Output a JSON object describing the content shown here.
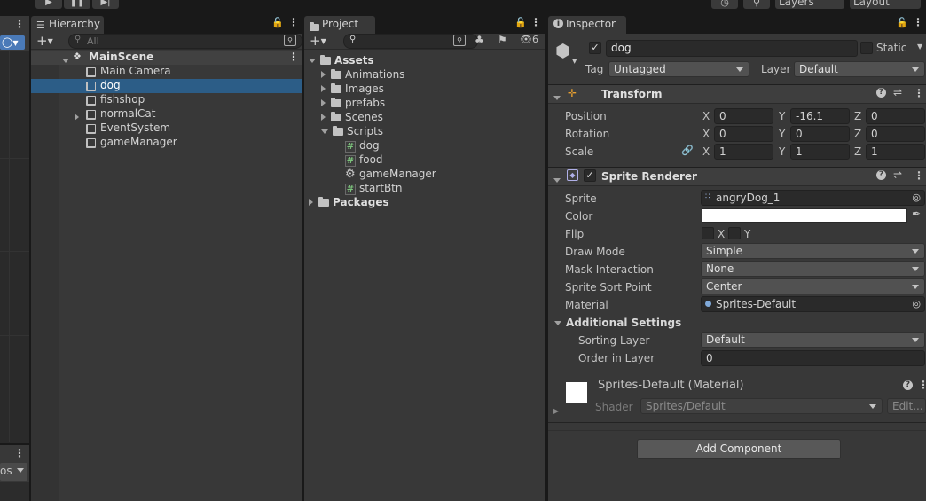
{
  "toolbar": {
    "play_icon": "play-icon",
    "pause_icon": "pause-icon",
    "step_icon": "step-icon",
    "layers_label": "Layers",
    "layout_label": "Layout"
  },
  "hierarchy": {
    "tab_label": "Hierarchy",
    "search_placeholder": "All",
    "scene_name": "MainScene",
    "items": [
      {
        "name": "Main Camera"
      },
      {
        "name": "dog"
      },
      {
        "name": "fishshop"
      },
      {
        "name": "normalCat"
      },
      {
        "name": "EventSystem"
      },
      {
        "name": "gameManager"
      }
    ]
  },
  "left_panel": {
    "dropdown_label": "os"
  },
  "project": {
    "tab_label": "Project",
    "hidden_count": "6",
    "tree": [
      {
        "name": "Assets"
      },
      {
        "name": "Animations"
      },
      {
        "name": "Images"
      },
      {
        "name": "prefabs"
      },
      {
        "name": "Scenes"
      },
      {
        "name": "Scripts"
      },
      {
        "name": "dog"
      },
      {
        "name": "food"
      },
      {
        "name": "gameManager"
      },
      {
        "name": "startBtn"
      },
      {
        "name": "Packages"
      }
    ]
  },
  "inspector": {
    "tab_label": "Inspector",
    "object_name": "dog",
    "static_label": "Static",
    "tag_label": "Tag",
    "tag_value": "Untagged",
    "layer_label": "Layer",
    "layer_value": "Default",
    "transform": {
      "title": "Transform",
      "position_label": "Position",
      "rotation_label": "Rotation",
      "scale_label": "Scale",
      "x": "X",
      "y": "Y",
      "z": "Z",
      "position": [
        "0",
        "-16.1",
        "0"
      ],
      "rotation": [
        "0",
        "0",
        "0"
      ],
      "scale": [
        "1",
        "1",
        "1"
      ]
    },
    "sprite_renderer": {
      "title": "Sprite Renderer",
      "sprite_label": "Sprite",
      "sprite_value": "angryDog_1",
      "color_label": "Color",
      "color_value": "#ffffff",
      "flip_label": "Flip",
      "flip_x": "X",
      "flip_y": "Y",
      "draw_mode_label": "Draw Mode",
      "draw_mode_value": "Simple",
      "mask_label": "Mask Interaction",
      "mask_value": "None",
      "sort_point_label": "Sprite Sort Point",
      "sort_point_value": "Center",
      "material_label": "Material",
      "material_value": "Sprites-Default",
      "additional_label": "Additional Settings",
      "sorting_layer_label": "Sorting Layer",
      "sorting_layer_value": "Default",
      "order_label": "Order in Layer",
      "order_value": "0"
    },
    "material": {
      "title": "Sprites-Default (Material)",
      "shader_label": "Shader",
      "shader_value": "Sprites/Default",
      "edit_label": "Edit..."
    },
    "add_component": "Add Component"
  }
}
